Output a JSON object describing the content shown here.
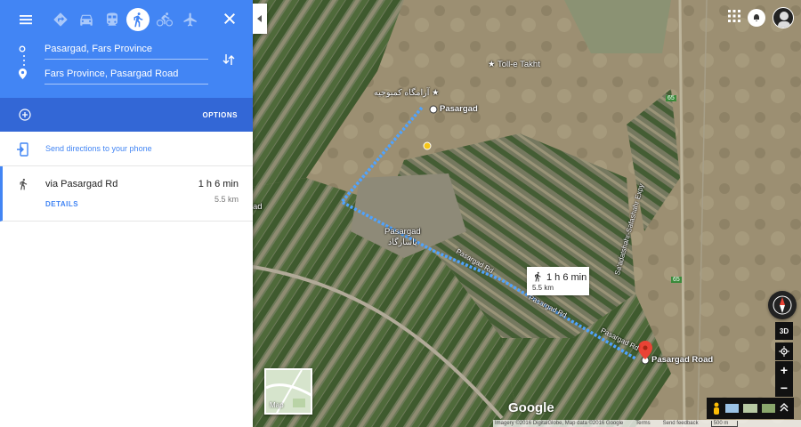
{
  "directions": {
    "modes": [
      {
        "name": "menu",
        "active": false
      },
      {
        "name": "best-mode",
        "active": false
      },
      {
        "name": "driving",
        "active": false
      },
      {
        "name": "transit",
        "active": false
      },
      {
        "name": "walking",
        "active": true
      },
      {
        "name": "cycling",
        "active": false
      },
      {
        "name": "flights",
        "active": false
      }
    ],
    "origin": "Pasargad, Fars Province",
    "destination": "Fars Province, Pasargad Road",
    "options_label": "OPTIONS",
    "send_label": "Send directions to your phone",
    "route": {
      "via": "via Pasargad Rd",
      "duration": "1 h 6 min",
      "distance": "5.5 km",
      "details_label": "DETAILS"
    }
  },
  "map": {
    "places": {
      "toll_e_takht": "Toll-e Takht",
      "mausoleum": "آرامگاه کمبوجیه",
      "pasargad": "Pasargad",
      "town_en": "Pasargad",
      "town_fa": "پاسارگاد",
      "road_1": "Pasargad Rd",
      "road_2": "Pasargad Rd",
      "road_3": "Pasargad Rd",
      "highway": "Sa'adatshahr-Safashahr Expy",
      "destination": "Pasargad Road",
      "partial_left": "ad",
      "road_num_1": "65",
      "road_num_2": "65"
    },
    "route_label": {
      "duration": "1 h 6 min",
      "distance": "5.5 km"
    },
    "thumbnail_label": "Map",
    "controls": {
      "three_d": "3D",
      "zoom_in": "+",
      "zoom_out": "−"
    },
    "google_logo": "Google",
    "attribution": {
      "imagery": "Imagery ©2016 DigitalGlobe, Map data ©2016 Google",
      "terms": "Terms",
      "feedback": "Send feedback",
      "scale": "500 m"
    }
  },
  "colors": {
    "accent_blue": "#4285f4",
    "accent_dark_blue": "#3367d6",
    "route_dots": "#4fa3ff",
    "pin_red": "#ea4335"
  }
}
